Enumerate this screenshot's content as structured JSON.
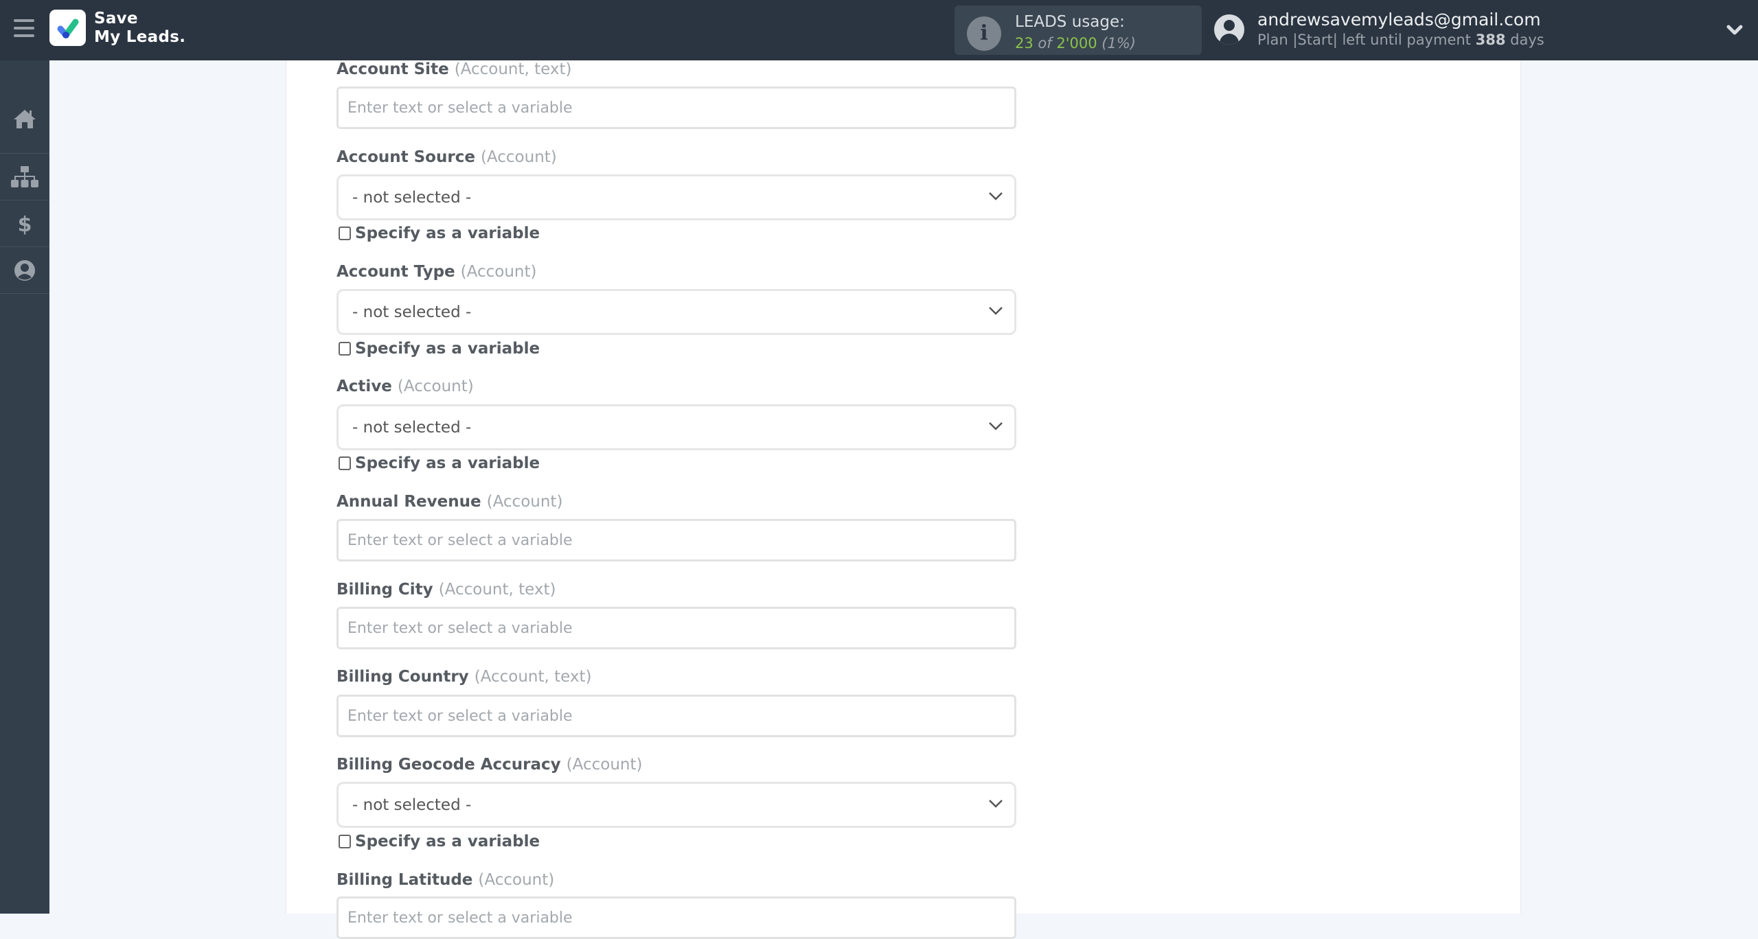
{
  "header": {
    "logo_line1": "Save",
    "logo_line2": "My Leads.",
    "usage_label": "LEADS usage:",
    "usage_used": "23",
    "usage_of": "of",
    "usage_total": "2'000",
    "usage_percent": "(1%)",
    "usage_fraction": 0.01,
    "user_email": "andrewsavemyleads@gmail.com",
    "plan_prefix": "Plan |Start| left until payment",
    "plan_days": "388",
    "plan_suffix": "days"
  },
  "sidebar": {
    "items": [
      {
        "name": "home",
        "icon": "home-icon"
      },
      {
        "name": "connections",
        "icon": "sitemap-icon"
      },
      {
        "name": "billing",
        "icon": "dollar-icon"
      },
      {
        "name": "account",
        "icon": "user-circle-icon"
      }
    ]
  },
  "form": {
    "placeholder": "Enter text or select a variable",
    "not_selected": "- not selected -",
    "specify_label": "Specify as a variable",
    "fields": [
      {
        "label": "Account Site",
        "hint": "(Account, text)",
        "type": "text"
      },
      {
        "label": "Account Source",
        "hint": "(Account)",
        "type": "select",
        "value": "- not selected -",
        "specify_checked": false
      },
      {
        "label": "Account Type",
        "hint": "(Account)",
        "type": "select",
        "value": "- not selected -",
        "specify_checked": false
      },
      {
        "label": "Active",
        "hint": "(Account)",
        "type": "select",
        "value": "- not selected -",
        "specify_checked": false
      },
      {
        "label": "Annual Revenue",
        "hint": "(Account)",
        "type": "text"
      },
      {
        "label": "Billing City",
        "hint": "(Account, text)",
        "type": "text"
      },
      {
        "label": "Billing Country",
        "hint": "(Account, text)",
        "type": "text"
      },
      {
        "label": "Billing Geocode Accuracy",
        "hint": "(Account)",
        "type": "select",
        "value": "- not selected -",
        "specify_checked": false
      },
      {
        "label": "Billing Latitude",
        "hint": "(Account)",
        "type": "text"
      }
    ]
  }
}
